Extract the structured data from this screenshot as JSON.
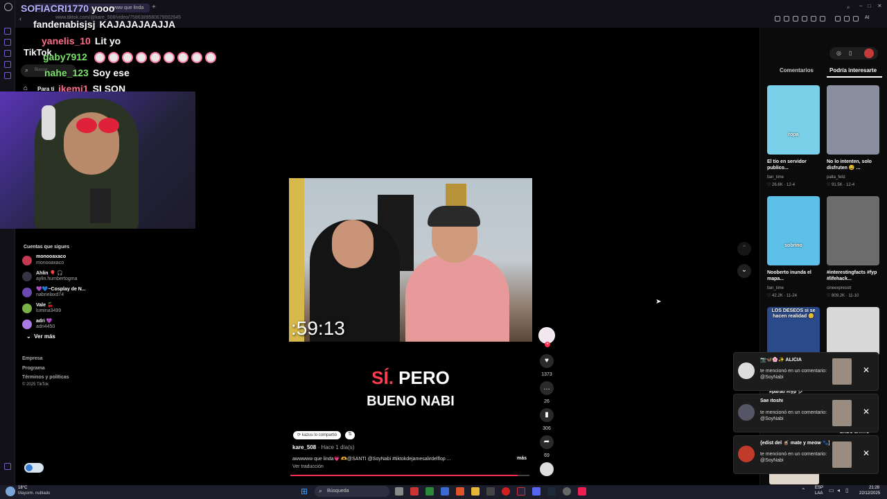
{
  "browser": {
    "tab_title": "awww que linda",
    "url": "www.tiktok.com/@kare_508/video/7586389580679002645",
    "chrome_ai_label": "AI"
  },
  "stream": {
    "streamer_name": "SOFIACRI1770",
    "streamer_msg": "yooo"
  },
  "chat": [
    {
      "user": "fandenabisjsj",
      "msg": "KAJAJAJAAJJA",
      "color": "#ffffff"
    },
    {
      "user": "yanelis_10",
      "msg": "Lit yo",
      "color": "#ff6b8a"
    },
    {
      "user": "gaby7912",
      "msg": "",
      "color": "#7be36b"
    },
    {
      "user": "nahe_123",
      "msg": "Soy ese",
      "color": "#7be36b"
    },
    {
      "user": "jkemi1",
      "msg": "SI SON",
      "color": "#ff6b8a"
    }
  ],
  "tiktok": {
    "logo": "TikTok",
    "search_placeholder": "Buscar",
    "nav_for_you": "Para ti",
    "following_header": "Cuentas que sigues",
    "following": [
      {
        "name": "monooaxaco",
        "handle": "monooaxaco",
        "color": "#c23a52"
      },
      {
        "name": "Ahlin 🎈 🎧",
        "handle": "aylin.humbertogma",
        "color": "#334"
      },
      {
        "name": "💜💙~Cosplay de N...",
        "handle": "nabrielaxd74",
        "color": "#6a4ab0"
      },
      {
        "name": "Vale 🍒",
        "handle": "lumina3499",
        "color": "#7ab04a"
      },
      {
        "name": "adri 💜",
        "handle": "adri4450",
        "color": "#a77be3"
      }
    ],
    "see_more": "Ver más",
    "footer_links": [
      "Empresa",
      "Programa",
      "Términos y políticas"
    ],
    "copyright": "© 2025 TikTok"
  },
  "video": {
    "timer": ":59:13",
    "caption_word_red": "SÍ.",
    "caption_word_white": " PERO",
    "caption_line2": "BUENO NABI",
    "shared_badge": "kazuu lo compartió",
    "author": "kare_508",
    "posted": " · Hace 1 día(s)",
    "description": "awwwww que linda💗 🫶@SANTI @SoyNabi  #tiktokdejamesalirdelflop ...",
    "more": "más",
    "translate": "Ver traducción",
    "likes": "1373",
    "comments": "26",
    "saves": "306",
    "shares": "69",
    "progress": 0.95
  },
  "right_panel": {
    "tab_comments": "Comentarios",
    "tab_interesting": "Podría interesarte",
    "videos": [
      {
        "title": "El tío en servidor publico...",
        "author": "llan_time",
        "stats": "♡ 26.6K · 12-4",
        "color": "#7ad0e8",
        "overlay": "ropa"
      },
      {
        "title": "No lo intenten, solo disfruten 😅 ...",
        "author": "palta_feliz",
        "stats": "♡ 91.5K · 12-4",
        "color": "#8a8fa0",
        "overlay": ""
      },
      {
        "title": "Nooberto inunda el mapa...",
        "author": "llan_time",
        "stats": "♡ 42.2K · 11-24",
        "color": "#5cc0e8",
        "overlay": "sobrino"
      },
      {
        "title": "#interestingfacts #fyp #lifehack...",
        "author": "cineexpresstt",
        "stats": "♡ 809.2K · 11-10",
        "color": "#6c6c6c",
        "overlay": ""
      },
      {
        "title": "",
        "author": "",
        "stats": "",
        "color": "#2a4a8a",
        "overlay": "LOS DESEOS si se hacen realidad 😊"
      },
      {
        "title": "MAMAAAA 😂 ...",
        "author": "",
        "stats": "",
        "color": "#d8d8d8",
        "overlay": ""
      }
    ]
  },
  "notifications": [
    {
      "user": "📷🦋🌸✨ ALICIA",
      "text": "te mencionó en un comentario: @SoyNabi",
      "color": "#ddd"
    },
    {
      "user": "Sae itoshi",
      "text": "te mencionó en un comentario: @SoyNabi",
      "color": "#556"
    },
    {
      "user": "{edist del 🧉 mate y meow 🐾} ☆",
      "text": "te mencionó en un comentario: @SoyNabi",
      "color": "#c23a2a"
    }
  ],
  "partial_texts": [
    "#parati #fyp シ",
    "LINDO GATITO"
  ],
  "taskbar": {
    "weather_temp": "18°C",
    "weather_desc": "Mayorm. nublado",
    "search": "Búsqueda",
    "lang": "ESP",
    "lang2": "LAA",
    "time": "21:28",
    "date": "22/12/2025"
  }
}
